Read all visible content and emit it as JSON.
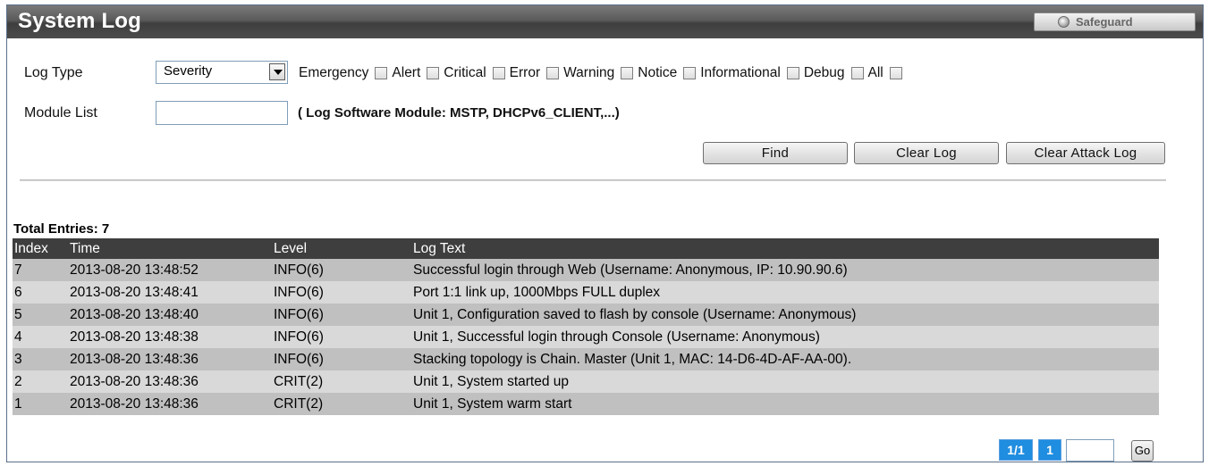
{
  "header": {
    "title": "System Log",
    "safeguard_label": "Safeguard"
  },
  "filters": {
    "log_type_label": "Log Type",
    "log_type_value": "Severity",
    "severities": [
      {
        "label": "Emergency",
        "checked": false
      },
      {
        "label": "Alert",
        "checked": false
      },
      {
        "label": "Critical",
        "checked": false
      },
      {
        "label": "Error",
        "checked": false
      },
      {
        "label": "Warning",
        "checked": false
      },
      {
        "label": "Notice",
        "checked": false
      },
      {
        "label": "Informational",
        "checked": false
      },
      {
        "label": "Debug",
        "checked": false
      },
      {
        "label": "All",
        "checked": false
      }
    ],
    "module_list_label": "Module List",
    "module_list_value": "",
    "module_hint": "( Log Software Module: MSTP, DHCPv6_CLIENT,...)"
  },
  "buttons": {
    "find": "Find",
    "clear_log": "Clear Log",
    "clear_attack_log": "Clear Attack Log"
  },
  "table": {
    "total_entries": "Total Entries: 7",
    "columns": [
      "Index",
      "Time",
      "Level",
      "Log Text"
    ],
    "rows": [
      {
        "index": "7",
        "time": "2013-08-20 13:48:52",
        "level": "INFO(6)",
        "text": "Successful login through Web (Username: Anonymous, IP: 10.90.90.6)"
      },
      {
        "index": "6",
        "time": "2013-08-20 13:48:41",
        "level": "INFO(6)",
        "text": "Port 1:1 link up, 1000Mbps FULL duplex"
      },
      {
        "index": "5",
        "time": "2013-08-20 13:48:40",
        "level": "INFO(6)",
        "text": "Unit 1, Configuration saved to flash by console (Username: Anonymous)"
      },
      {
        "index": "4",
        "time": "2013-08-20 13:48:38",
        "level": "INFO(6)",
        "text": "Unit 1, Successful login through Console (Username: Anonymous)"
      },
      {
        "index": "3",
        "time": "2013-08-20 13:48:36",
        "level": "INFO(6)",
        "text": "Stacking topology is Chain. Master (Unit 1, MAC: 14-D6-4D-AF-AA-00)."
      },
      {
        "index": "2",
        "time": "2013-08-20 13:48:36",
        "level": "CRIT(2)",
        "text": "Unit 1, System started up"
      },
      {
        "index": "1",
        "time": "2013-08-20 13:48:36",
        "level": "CRIT(2)",
        "text": "Unit 1, System warm start"
      }
    ]
  },
  "pagination": {
    "page_of": "1/1",
    "current_page": "1",
    "goto_value": "",
    "go_label": "Go"
  },
  "colors": {
    "header_bg": "#3e3e3e",
    "row_dark": "#c0c0c0",
    "row_light": "#d9d9d9",
    "page_accent": "#1f8de0"
  }
}
